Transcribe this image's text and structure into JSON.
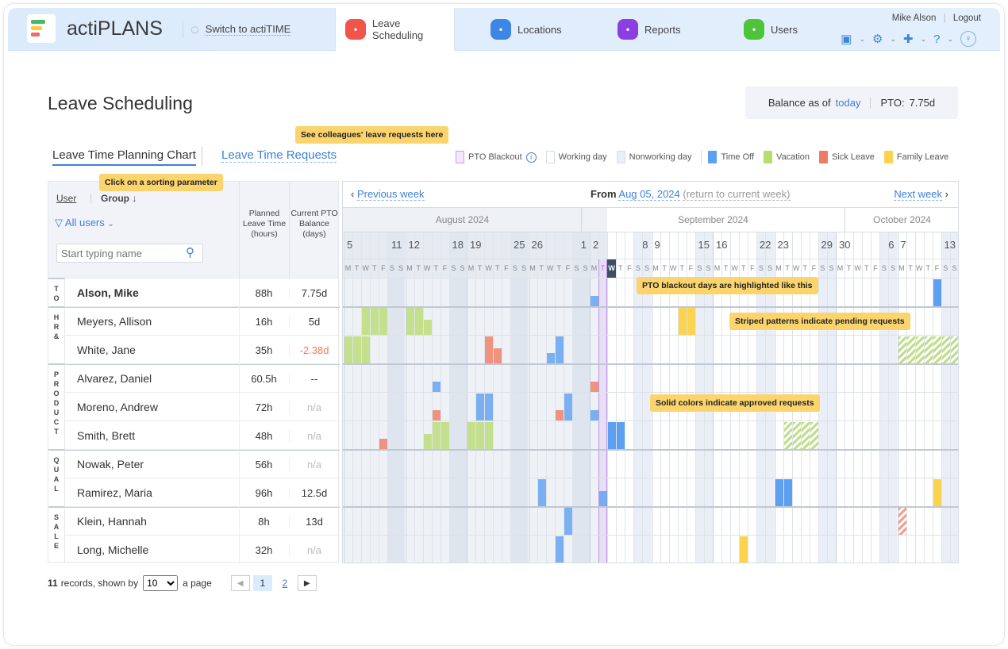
{
  "app": {
    "brand": "actiPLANS",
    "switch_label": "Switch to actiTIME",
    "user_name": "Mike Alson",
    "logout": "Logout"
  },
  "nav_tabs": [
    {
      "label": "Leave Scheduling",
      "icon": "leave-scheduling-icon",
      "color": "#f0544a",
      "active": true
    },
    {
      "label": "Locations",
      "icon": "locations-icon",
      "color": "#3e86e6"
    },
    {
      "label": "Reports",
      "icon": "reports-icon",
      "color": "#8b3fe0"
    },
    {
      "label": "Users",
      "icon": "users-icon",
      "color": "#4ec43a"
    }
  ],
  "page": {
    "title": "Leave Scheduling",
    "balance_label": "Balance as of",
    "balance_link": "today",
    "pto_label": "PTO:",
    "pto_value": "7.75d"
  },
  "view_tabs": {
    "planning": "Leave Time Planning Chart",
    "requests": "Leave Time Requests"
  },
  "legend": [
    {
      "label": "PTO Blackout",
      "color": "#f3e8fd",
      "border": "#c99af0"
    },
    {
      "label": "Working day",
      "color": "#ffffff",
      "border": "#d6dce4"
    },
    {
      "label": "Nonworking day",
      "color": "#e9eef7",
      "border": "#d6dce4"
    },
    {
      "label": "Time Off",
      "color": "#5d9ff0"
    },
    {
      "label": "Vacation",
      "color": "#b9dc73"
    },
    {
      "label": "Sick Leave",
      "color": "#ef7b62"
    },
    {
      "label": "Family Leave",
      "color": "#fbd34d"
    }
  ],
  "tips": {
    "requests": "See colleagues' leave requests here",
    "sorting": "Click on a sorting parameter",
    "blackout": "PTO blackout days are highlighted like this",
    "pending": "Striped patterns indicate pending requests",
    "approved": "Solid colors indicate approved requests"
  },
  "table": {
    "sort_user": "User",
    "sort_group": "Group ↓",
    "filter": "All users",
    "search_placeholder": "Start typing name",
    "col_planned": "Planned Leave Time (hours)",
    "col_balance": "Current PTO Balance (days)"
  },
  "groups": [
    {
      "label": "TO",
      "rows": 1
    },
    {
      "label": "HR&",
      "rows": 2
    },
    {
      "label": "PRODUCT",
      "rows": 3
    },
    {
      "label": "QUAL",
      "rows": 2
    },
    {
      "label": "SALE",
      "rows": 2
    }
  ],
  "rows": [
    {
      "name": "Alson, Mike",
      "bold": true,
      "planned": "88h",
      "balance": "7.75d",
      "bars": [
        {
          "date": "2024-09-02",
          "type": "timeoff",
          "fraction": 0.38
        },
        {
          "date": "2024-10-11",
          "type": "timeoff",
          "fraction": 1
        }
      ]
    },
    {
      "name": "Meyers, Allison",
      "planned": "16h",
      "balance": "5d",
      "bars": [
        {
          "date": "2024-08-07",
          "type": "vacation",
          "fraction": 1
        },
        {
          "date": "2024-08-08",
          "type": "vacation",
          "fraction": 1
        },
        {
          "date": "2024-08-09",
          "type": "vacation",
          "fraction": 1
        },
        {
          "date": "2024-08-12",
          "type": "vacation",
          "fraction": 1
        },
        {
          "date": "2024-08-13",
          "type": "vacation",
          "fraction": 1
        },
        {
          "date": "2024-08-14",
          "type": "vacation",
          "fraction": 0.55
        },
        {
          "date": "2024-09-12",
          "type": "family",
          "fraction": 1
        },
        {
          "date": "2024-09-13",
          "type": "family",
          "fraction": 1
        }
      ]
    },
    {
      "name": "White, Jane",
      "planned": "35h",
      "balance": "-2.38d",
      "balance_color": "#ef7b62",
      "bars": [
        {
          "date": "2024-08-05",
          "type": "vacation",
          "fraction": 1
        },
        {
          "date": "2024-08-06",
          "type": "vacation",
          "fraction": 1
        },
        {
          "date": "2024-08-07",
          "type": "vacation",
          "fraction": 1
        },
        {
          "date": "2024-08-21",
          "type": "sick",
          "fraction": 1
        },
        {
          "date": "2024-08-22",
          "type": "sick",
          "fraction": 0.55
        },
        {
          "date": "2024-08-28",
          "type": "timeoff",
          "fraction": 0.38
        },
        {
          "date": "2024-08-29",
          "type": "timeoff",
          "fraction": 1
        },
        {
          "date": "2024-10-07",
          "type": "vacation",
          "fraction": 1,
          "pending": true
        },
        {
          "date": "2024-10-08",
          "type": "vacation",
          "fraction": 1,
          "pending": true
        },
        {
          "date": "2024-10-09",
          "type": "vacation",
          "fraction": 1,
          "pending": true
        },
        {
          "date": "2024-10-10",
          "type": "vacation",
          "fraction": 1,
          "pending": true
        },
        {
          "date": "2024-10-11",
          "type": "vacation",
          "fraction": 1,
          "pending": true
        },
        {
          "date": "2024-10-12",
          "type": "vacation",
          "fraction": 1,
          "pending": true
        },
        {
          "date": "2024-10-13",
          "type": "vacation",
          "fraction": 1,
          "pending": true
        }
      ]
    },
    {
      "name": "Alvarez, Daniel",
      "planned": "60.5h",
      "balance": "--",
      "bars": [
        {
          "date": "2024-08-15",
          "type": "timeoff",
          "fraction": 0.38
        },
        {
          "date": "2024-09-02",
          "type": "sick",
          "fraction": 0.38
        }
      ]
    },
    {
      "name": "Moreno, Andrew",
      "planned": "72h",
      "balance": "n/a",
      "balance_color": "#bbb",
      "bars": [
        {
          "date": "2024-08-15",
          "type": "sick",
          "fraction": 0.38
        },
        {
          "date": "2024-08-20",
          "type": "timeoff",
          "fraction": 1
        },
        {
          "date": "2024-08-21",
          "type": "timeoff",
          "fraction": 1
        },
        {
          "date": "2024-08-29",
          "type": "sick",
          "fraction": 0.38
        },
        {
          "date": "2024-08-30",
          "type": "timeoff",
          "fraction": 1
        },
        {
          "date": "2024-09-02",
          "type": "timeoff",
          "fraction": 0.38
        }
      ]
    },
    {
      "name": "Smith, Brett",
      "planned": "48h",
      "balance": "n/a",
      "balance_color": "#bbb",
      "bars": [
        {
          "date": "2024-08-09",
          "type": "sick",
          "fraction": 0.38
        },
        {
          "date": "2024-08-14",
          "type": "vacation",
          "fraction": 0.55
        },
        {
          "date": "2024-08-15",
          "type": "vacation",
          "fraction": 1
        },
        {
          "date": "2024-08-16",
          "type": "vacation",
          "fraction": 1
        },
        {
          "date": "2024-08-19",
          "type": "vacation",
          "fraction": 1
        },
        {
          "date": "2024-08-20",
          "type": "vacation",
          "fraction": 1
        },
        {
          "date": "2024-08-21",
          "type": "vacation",
          "fraction": 1
        },
        {
          "date": "2024-09-04",
          "type": "timeoff",
          "fraction": 1
        },
        {
          "date": "2024-09-05",
          "type": "timeoff",
          "fraction": 1
        },
        {
          "date": "2024-09-24",
          "type": "vacation",
          "fraction": 1,
          "pending": true
        },
        {
          "date": "2024-09-25",
          "type": "vacation",
          "fraction": 1,
          "pending": true
        },
        {
          "date": "2024-09-26",
          "type": "vacation",
          "fraction": 1,
          "pending": true
        },
        {
          "date": "2024-09-27",
          "type": "vacation",
          "fraction": 1,
          "pending": true
        }
      ]
    },
    {
      "name": "Nowak, Peter",
      "planned": "56h",
      "balance": "n/a",
      "balance_color": "#bbb",
      "bars": []
    },
    {
      "name": "Ramirez, Maria",
      "planned": "96h",
      "balance": "12.5d",
      "bars": [
        {
          "date": "2024-08-27",
          "type": "timeoff",
          "fraction": 1
        },
        {
          "date": "2024-09-03",
          "type": "timeoff",
          "fraction": 0.55
        },
        {
          "date": "2024-09-23",
          "type": "timeoff",
          "fraction": 1
        },
        {
          "date": "2024-09-24",
          "type": "timeoff",
          "fraction": 1
        },
        {
          "date": "2024-10-11",
          "type": "family",
          "fraction": 1
        }
      ]
    },
    {
      "name": "Klein, Hannah",
      "planned": "8h",
      "balance": "13d",
      "bars": [
        {
          "date": "2024-08-30",
          "type": "timeoff",
          "fraction": 1
        },
        {
          "date": "2024-10-07",
          "type": "sick",
          "fraction": 1,
          "pending": true
        }
      ]
    },
    {
      "name": "Long, Michelle",
      "planned": "32h",
      "balance": "n/a",
      "balance_color": "#bbb",
      "bars": [
        {
          "date": "2024-08-29",
          "type": "timeoff",
          "fraction": 1
        },
        {
          "date": "2024-09-19",
          "type": "family",
          "fraction": 1
        }
      ]
    }
  ],
  "chart": {
    "prev": "Previous week",
    "from_label": "From",
    "from_date": "Aug 05, 2024",
    "return_label": "(return to current week)",
    "next": "Next week",
    "start": "2024-08-05",
    "days": 70,
    "today": "2024-09-04",
    "blackout": [
      "2024-09-03"
    ],
    "months": [
      {
        "label": "August 2024",
        "from": "2024-08-05",
        "to": "2024-08-31"
      },
      {
        "label": "September 2024",
        "from": "2024-09-01",
        "to": "2024-09-30"
      },
      {
        "label": "October 2024",
        "from": "2024-10-01",
        "to": "2024-10-13"
      }
    ],
    "day_letters": [
      "M",
      "T",
      "W",
      "T",
      "F",
      "S",
      "S"
    ],
    "colors": {
      "timeoff": "#5d9ff0",
      "vacation": "#b9dc73",
      "sick": "#ef7b62",
      "family": "#fbd34d"
    }
  },
  "pager": {
    "count": "11",
    "text": "records, shown by",
    "per_page": "10",
    "suffix": "a page",
    "pages": [
      "1",
      "2"
    ]
  }
}
